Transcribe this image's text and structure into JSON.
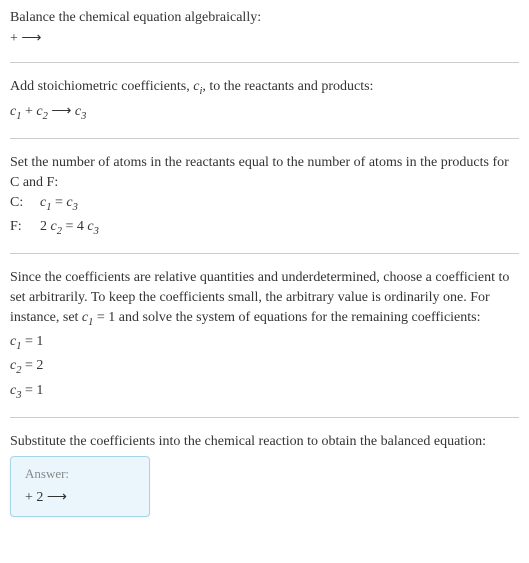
{
  "s1": {
    "line1": "Balance the chemical equation algebraically:",
    "line2_pre": " + ",
    "line2_arrow": "⟶"
  },
  "s2": {
    "line1_pre": "Add stoichiometric coefficients, ",
    "line1_ci": "c",
    "line1_ci_sub": "i",
    "line1_post": ", to the reactants and products:",
    "c1": "c",
    "c1_sub": "1",
    "plus": " + ",
    "c2": "c",
    "c2_sub": "2",
    "arrow": " ⟶ ",
    "c3": "c",
    "c3_sub": "3"
  },
  "s3": {
    "line1": "Set the number of atoms in the reactants equal to the number of atoms in the products for C and F:",
    "rowC_label": "C: ",
    "rowC_lhs_c": "c",
    "rowC_lhs_sub": "1",
    "rowC_eq": " = ",
    "rowC_rhs_c": "c",
    "rowC_rhs_sub": "3",
    "rowF_label": "F: ",
    "rowF_lhs_coef": "2 ",
    "rowF_lhs_c": "c",
    "rowF_lhs_sub": "2",
    "rowF_eq": " = 4 ",
    "rowF_rhs_c": "c",
    "rowF_rhs_sub": "3"
  },
  "s4": {
    "text_pre": "Since the coefficients are relative quantities and underdetermined, choose a coefficient to set arbitrarily. To keep the coefficients small, the arbitrary value is ordinarily one. For instance, set ",
    "set_c": "c",
    "set_sub": "1",
    "set_eq": " = 1",
    "text_post": " and solve the system of equations for the remaining coefficients:",
    "r1_c": "c",
    "r1_sub": "1",
    "r1_val": " = 1",
    "r2_c": "c",
    "r2_sub": "2",
    "r2_val": " = 2",
    "r3_c": "c",
    "r3_sub": "3",
    "r3_val": " = 1"
  },
  "s5": {
    "line1": "Substitute the coefficients into the chemical reaction to obtain the balanced equation:",
    "answer_label": "Answer:",
    "answer_eq_pre": " + 2 ",
    "answer_arrow": " ⟶ "
  }
}
